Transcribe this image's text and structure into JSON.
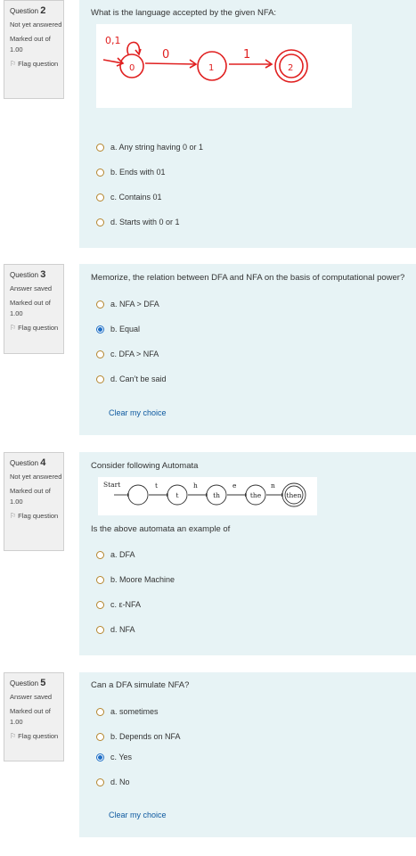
{
  "questions": [
    {
      "info": {
        "label": "Question",
        "number": "2",
        "state": "Not yet answered",
        "grade": "Marked out of 1.00",
        "flag": "Flag question"
      },
      "text": "What is the language accepted by the given NFA:",
      "options": [
        {
          "label": "a. Any string having 0 or 1",
          "selected": false
        },
        {
          "label": "b. Ends with 01",
          "selected": false
        },
        {
          "label": "c. Contains 01",
          "selected": false
        },
        {
          "label": "d. Starts with 0 or 1",
          "selected": false
        }
      ],
      "figure": {
        "loop": "0,1",
        "q0": "0",
        "q1": "1",
        "q2": "2",
        "t1": "0",
        "t2": "1"
      }
    },
    {
      "info": {
        "label": "Question",
        "number": "3",
        "state": "Answer saved",
        "grade": "Marked out of 1.00",
        "flag": "Flag question"
      },
      "text": "Memorize, the relation between DFA and NFA on the basis of computational power?",
      "options": [
        {
          "label": "a. NFA > DFA",
          "selected": false
        },
        {
          "label": "b. Equal",
          "selected": true
        },
        {
          "label": "c. DFA > NFA",
          "selected": false
        },
        {
          "label": "d. Can’t be said",
          "selected": false
        }
      ],
      "clear": "Clear my choice"
    },
    {
      "info": {
        "label": "Question",
        "number": "4",
        "state": "Not yet answered",
        "grade": "Marked out of 1.00",
        "flag": "Flag question"
      },
      "text": "Consider following Automata",
      "text2": "Is the above automata an example of",
      "options": [
        {
          "label": "a. DFA",
          "selected": false
        },
        {
          "label": "b. Moore Machine",
          "selected": false
        },
        {
          "label": "c. ε-NFA",
          "selected": false
        },
        {
          "label": "d. NFA",
          "selected": false
        }
      ],
      "figure": {
        "start": "Start",
        "edges": [
          "t",
          "h",
          "e",
          "n"
        ],
        "states": [
          "",
          "t",
          "th",
          "the",
          "then"
        ]
      }
    },
    {
      "info": {
        "label": "Question",
        "number": "5",
        "state": "Answer saved",
        "grade": "Marked out of 1.00",
        "flag": "Flag question"
      },
      "text": "Can a DFA simulate NFA?",
      "options": [
        {
          "label": "a. sometimes",
          "selected": false
        },
        {
          "label": "b. Depends on NFA",
          "selected": false
        },
        {
          "label": "c. Yes",
          "selected": true
        },
        {
          "label": "d. No",
          "selected": false
        }
      ],
      "clear": "Clear my choice"
    }
  ]
}
